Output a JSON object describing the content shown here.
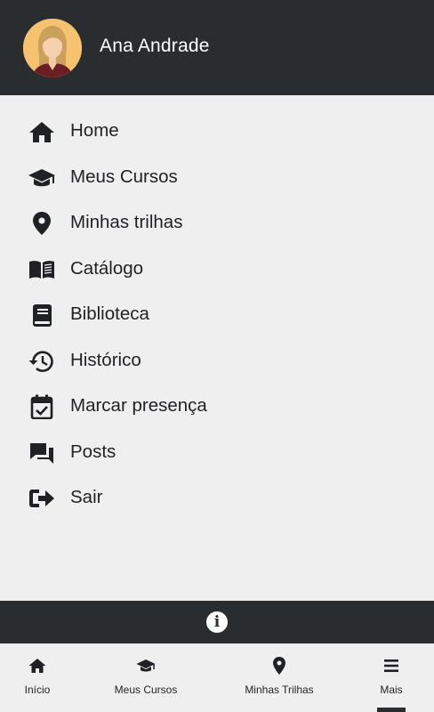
{
  "user": {
    "name": "Ana Andrade"
  },
  "menu": {
    "items": [
      {
        "label": "Home",
        "icon": "home-icon"
      },
      {
        "label": "Meus Cursos",
        "icon": "graduation-cap-icon"
      },
      {
        "label": "Minhas trilhas",
        "icon": "map-pin-icon"
      },
      {
        "label": "Catálogo",
        "icon": "open-book-icon"
      },
      {
        "label": "Biblioteca",
        "icon": "book-icon"
      },
      {
        "label": "Histórico",
        "icon": "history-icon"
      },
      {
        "label": "Marcar presença",
        "icon": "calendar-check-icon"
      },
      {
        "label": "Posts",
        "icon": "chat-bubbles-icon"
      },
      {
        "label": "Sair",
        "icon": "sign-out-icon"
      }
    ]
  },
  "info": {
    "icon": "info-icon",
    "glyph": "i"
  },
  "bottom_nav": {
    "items": [
      {
        "label": "Início",
        "icon": "home-icon"
      },
      {
        "label": "Meus Cursos",
        "icon": "graduation-cap-icon"
      },
      {
        "label": "Minhas Trilhas",
        "icon": "map-pin-icon"
      },
      {
        "label": "Mais",
        "icon": "menu-icon",
        "active": true
      }
    ]
  },
  "colors": {
    "header_bg": "#2a2d30",
    "body_bg": "#efefef",
    "text": "#1f2124",
    "avatar_bg": "#f6c26f"
  }
}
